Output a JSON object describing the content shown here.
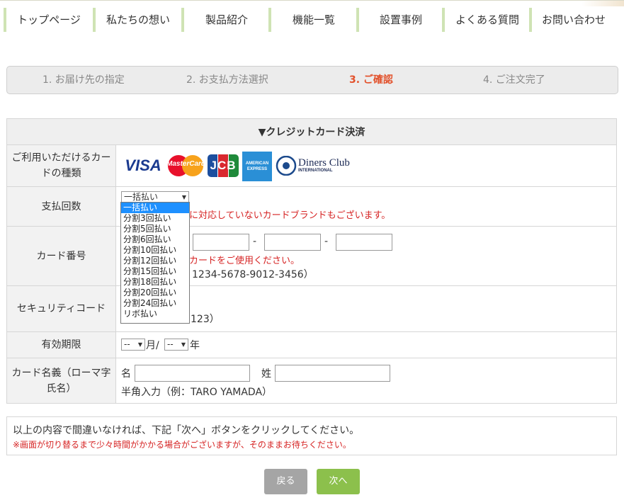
{
  "nav": {
    "items": [
      {
        "label": "トップページ"
      },
      {
        "label": "私たちの想い"
      },
      {
        "label": "製品紹介"
      },
      {
        "label": "機能一覧"
      },
      {
        "label": "設置事例"
      },
      {
        "label": "よくある質問"
      },
      {
        "label": "お問い合わせ"
      }
    ]
  },
  "steps": [
    {
      "label": "1. お届け先の指定"
    },
    {
      "label": "2. お支払方法選択"
    },
    {
      "label": "3. ご確認"
    },
    {
      "label": "4. ご注文完了"
    }
  ],
  "form": {
    "title": "▼クレジットカード決済",
    "card_types_label": "ご利用いただけるカードの種類",
    "card_logos": [
      "VISA",
      "MasterCard",
      "JCB",
      "AMERICAN EXPRESS",
      "Diners Club",
      "INTERNATIONAL"
    ],
    "installments": {
      "label": "支払回数",
      "selected": "一括払い",
      "note": "に対応していないカードブランドもございます。",
      "options": [
        "一括払い",
        "分割3回払い",
        "分割5回払い",
        "分割6回払い",
        "分割10回払い",
        "分割12回払い",
        "分割15回払い",
        "分割18回払い",
        "分割20回払い",
        "分割24回払い",
        "リボ払い"
      ]
    },
    "card_number": {
      "label": "カード番号",
      "sep": "-",
      "note": "カードをご使用ください。",
      "example": "1234-5678-9012-3456）"
    },
    "security": {
      "label": "セキュリティコード",
      "example": "123）"
    },
    "expiry": {
      "label": "有効期限",
      "month_selected": "--",
      "month_unit": "月/",
      "year_selected": "--",
      "year_unit": "年"
    },
    "name": {
      "label": "カード名義（ローマ字氏名）",
      "first_label": "名",
      "last_label": "姓",
      "hint": "半角入力（例：TARO YAMADA）"
    }
  },
  "notice": {
    "line1": "以上の内容で間違いなければ、下記「次へ」ボタンをクリックしてください。",
    "line2": "※画面が切り替るまで少々時間がかかる場合がございますが、そのままお待ちください。"
  },
  "buttons": {
    "back": "戻る",
    "next": "次へ"
  },
  "colors": {
    "accent": "#e2512b",
    "nav_border": "#cfe3b4",
    "next_btn": "#8cc04c",
    "back_btn": "#a5a5a5",
    "highlight": "#1e90ff"
  }
}
